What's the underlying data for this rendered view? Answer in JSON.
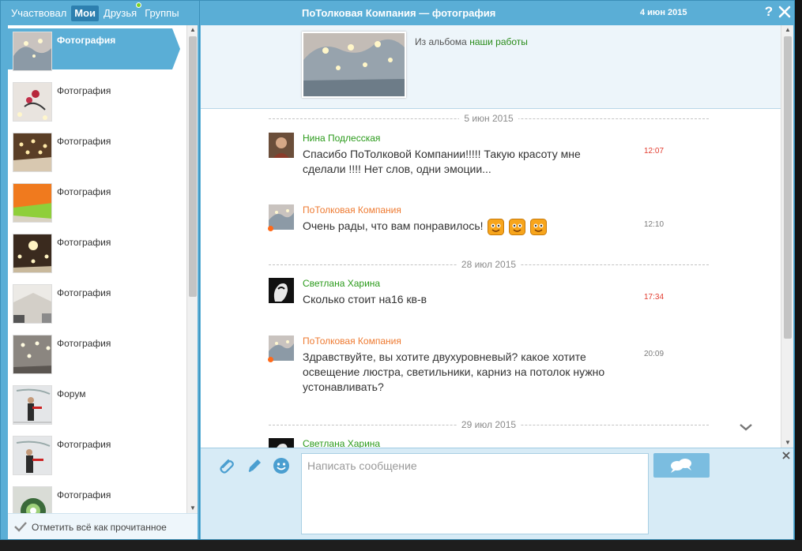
{
  "tabs": [
    {
      "label": "Участвовал",
      "active": false
    },
    {
      "label": "Мои",
      "active": true
    },
    {
      "label": "Друзья",
      "active": false,
      "online_indicator": true
    },
    {
      "label": "Группы",
      "active": false
    }
  ],
  "header": {
    "title": "ПоТолковая Компания — фотография",
    "date": "4 июн 2015",
    "help_label": "?",
    "close_icon": "close-icon"
  },
  "sidebar": {
    "items": [
      {
        "label": "Фотография",
        "selected": true
      },
      {
        "label": "Фотография",
        "selected": false
      },
      {
        "label": "Фотография",
        "selected": false
      },
      {
        "label": "Фотография",
        "selected": false
      },
      {
        "label": "Фотография",
        "selected": false
      },
      {
        "label": "Фотография",
        "selected": false
      },
      {
        "label": "Фотография",
        "selected": false
      },
      {
        "label": "Форум",
        "selected": false
      },
      {
        "label": "Фотография",
        "selected": false
      },
      {
        "label": "Фотография",
        "selected": false
      }
    ],
    "mark_all_read": "Отметить всё как прочитанное"
  },
  "album": {
    "prefix": "Из альбома",
    "link": "наши работы"
  },
  "date_separators": [
    "5 июн 2015",
    "28 июл 2015",
    "29 июл 2015"
  ],
  "messages": [
    {
      "author": "Нина Подлесская",
      "author_color": "green",
      "text": "Спасибо ПоТолковой Компании!!!!! Такую красоту мне сделали !!!! Нет слов, одни эмоции...",
      "time": "12:07",
      "time_color": "red"
    },
    {
      "author": "ПоТолковая Компания",
      "author_color": "orange",
      "text": "Очень рады, что вам понравилось!",
      "time": "12:10",
      "time_color": "gray",
      "emoji_count": 3
    },
    {
      "author": "Светлана Харина",
      "author_color": "green",
      "text": "Сколько стоит на16 кв-в",
      "time": "17:34",
      "time_color": "red"
    },
    {
      "author": "ПоТолковая Компания",
      "author_color": "orange",
      "text": "Здравствуйте, вы хотите двухуровневый? какое хотите освещение люстра, светильники, карниз на потолок нужно устонавливать?",
      "time": "20:09",
      "time_color": "gray"
    },
    {
      "author": "Светлана Харина",
      "author_color": "green",
      "text": "",
      "time": "",
      "time_color": "red"
    }
  ],
  "composer": {
    "placeholder": "Написать сообщение",
    "tools": [
      "paperclip-icon",
      "pencil-icon",
      "smiley-icon"
    ],
    "send_icon": "chat-bubbles-icon"
  },
  "colors": {
    "accent": "#5aaed6",
    "author_green": "#2a9a1a",
    "author_orange": "#ee7a31",
    "time_red": "#e23b2e"
  }
}
